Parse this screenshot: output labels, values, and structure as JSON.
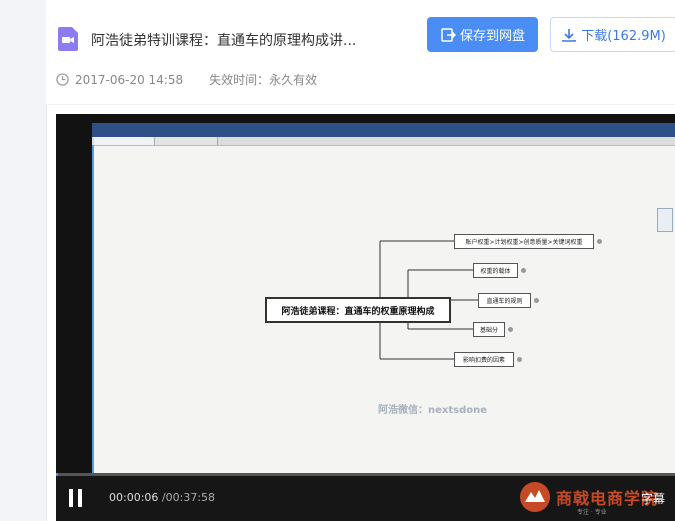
{
  "file": {
    "title": "阿浩徒弟特训课程：直通车的原理构成讲...",
    "created": "2017-06-20 14:58",
    "expiry_label": "失效时间：",
    "expiry_value": "永久有效"
  },
  "actions": {
    "save_label": "保存到网盘",
    "download_label": "下载(162.9M)"
  },
  "video": {
    "mindmap_root": "阿浩徒弟课程：直通车的权重原理构成",
    "mindmap_nodes": [
      "账户权重>计划权重>创意质量>关键词权重",
      "权重的载体",
      "直通车的规则",
      "基础分",
      "影响扣费的因素"
    ],
    "watermark": "阿浩微信：nextsdone",
    "progress_fraction": 0.0027,
    "current_time": "00:00:06",
    "total_time": "/00:37:58",
    "subtitle_label": "字幕",
    "brand_name": "商戟电商学院",
    "brand_tagline": "专注 · 专业"
  },
  "colors": {
    "primary": "#4a8ef5",
    "brand": "#c74a27"
  }
}
